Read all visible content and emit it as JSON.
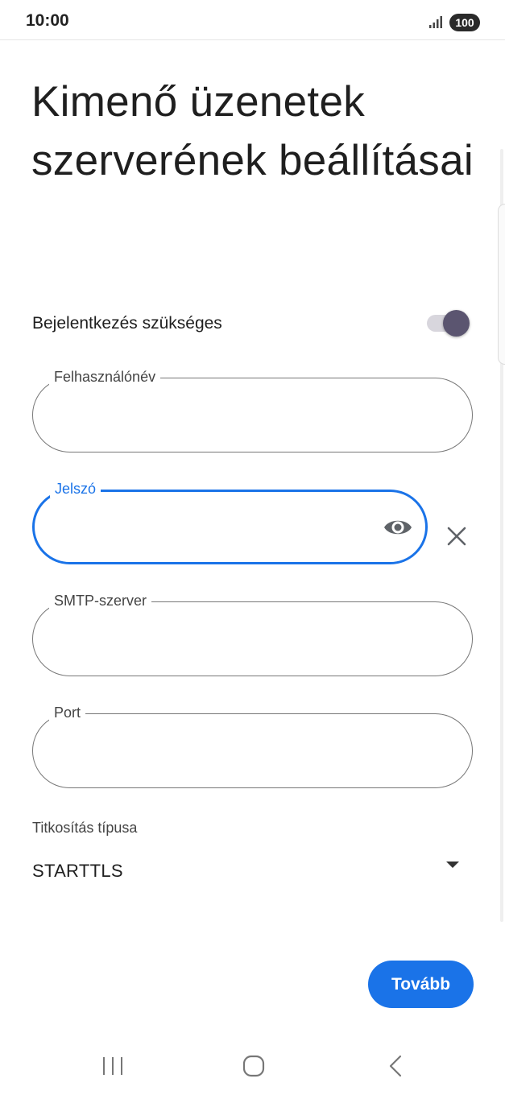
{
  "status_bar": {
    "time": "10:00",
    "battery": "100",
    "signal_icon": "signal-strength-icon"
  },
  "page": {
    "title": "Kimenő üzenetek szerverének beállításai"
  },
  "login_required": {
    "label": "Bejelentkezés szükséges",
    "enabled": true
  },
  "fields": {
    "username": {
      "label": "Felhasználónév",
      "value": ""
    },
    "password": {
      "label": "Jelszó",
      "value": "",
      "focused": true
    },
    "smtp_server": {
      "label": "SMTP-szerver",
      "value": ""
    },
    "port": {
      "label": "Port",
      "value": ""
    }
  },
  "encryption": {
    "label": "Titkosítás típusa",
    "selected": "STARTTLS"
  },
  "actions": {
    "next_label": "Tovább"
  },
  "colors": {
    "accent": "#1a73e8",
    "toggle_thumb": "#5b5570",
    "toggle_track": "#d8d6dd",
    "outline": "#777777"
  },
  "icons": {
    "show_password": "eye-icon",
    "clear": "close-icon",
    "dropdown": "caret-down-icon",
    "nav_recents": "recents-icon",
    "nav_home": "home-icon",
    "nav_back": "back-icon"
  }
}
